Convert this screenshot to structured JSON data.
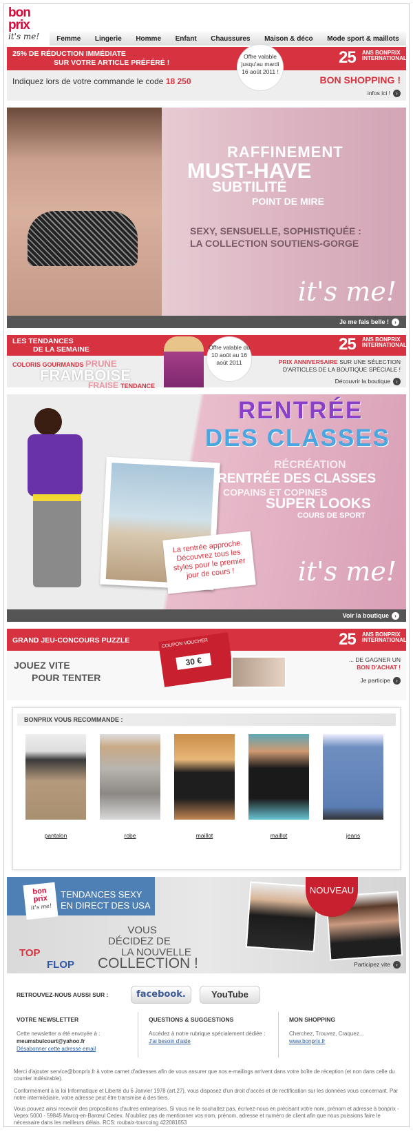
{
  "logo": {
    "line1": "bon",
    "line2": "prix",
    "tagline": "it's me!"
  },
  "nav": [
    "Femme",
    "Lingerie",
    "Homme",
    "Enfant",
    "Chaussures",
    "Maison & déco",
    "Mode sport & maillots"
  ],
  "promo": {
    "line1": "25% DE RÉDUCTION IMMÉDIATE",
    "line2": "SUR VOTRE ARTICLE PRÉFÉRÉ !",
    "offer": "Offre valable jusqu'au mardi 16 août 2011 !",
    "badge_num": "25",
    "badge_text": "ANS BONPRIX INTERNATIONAL",
    "code_text": "Indiquez lors de votre commande le code",
    "code": "18 250",
    "shopping": "BON SHOPPING !",
    "info": "infos ici !"
  },
  "hero1": {
    "w1": "RAFFINEMENT",
    "w2": "MUST-HAVE",
    "w3": "SUBTILITÉ",
    "w4": "POINT DE MIRE",
    "sub1": "SEXY, SENSUELLE, SOPHISTIQUÉE :",
    "sub2": "LA COLLECTION SOUTIENS-GORGE",
    "tagline": "it's me!",
    "link": "Je me fais belle !"
  },
  "trends": {
    "title1": "LES TENDANCES",
    "title2": "DE LA SEMAINE",
    "coloris": "COLORIS GOURMANDS",
    "prune": "PRUNE",
    "framboise": "FRAMBOISE",
    "fraise": "FRAISE",
    "tendance": "TENDANCE",
    "offer": "Offre valable du 10 août au 16 août 2011",
    "prix_b": "PRIX ANNIVERSAIRE",
    "prix_t": "SUR UNE SÉLECTION",
    "prix_t2": "D'ARTICLES DE LA BOUTIQUE SPÉCIALE !",
    "link": "Découvrir la boutique"
  },
  "hero2": {
    "rentree": "RENTRÉE",
    "classes": "DES CLASSES",
    "l1": "RÉCRÉATION",
    "l2": "RENTRÉE DES CLASSES",
    "l3": "COPAINS ET COPINES",
    "l4": "SUPER LOOKS",
    "l5": "COURS DE SPORT",
    "note": "La rentrée approche. Découvrez tous les styles pour le premier jour de cours !",
    "tagline": "it's me!",
    "link": "Voir la boutique"
  },
  "contest": {
    "title": "GRAND JEU-CONCOURS PUZZLE",
    "j1": "JOUEZ VITE",
    "j2": "POUR TENTER",
    "r1": "... DE GAGNER UN",
    "r2": "BON D'ACHAT !",
    "link": "Je participe",
    "voucher_top": "COUPON VOUCHER",
    "voucher_amt": "30 €"
  },
  "reco": {
    "title": "BONPRIX VOUS RECOMMANDE :",
    "items": [
      {
        "label": "pantalon"
      },
      {
        "label": "robe"
      },
      {
        "label": "maillot"
      },
      {
        "label": "maillot"
      },
      {
        "label": "jeans"
      }
    ]
  },
  "tendances": {
    "t1": "TENDANCES SEXY",
    "t2": "EN DIRECT DES USA",
    "v1": "VOUS",
    "v2": "DÉCIDEZ DE",
    "v3": "LA NOUVELLE",
    "v4": "COLLECTION !",
    "top": "TOP",
    "flop": "FLOP",
    "nouveau": "NOUVEAU",
    "link": "Participez vite"
  },
  "social": {
    "label": "RETROUVEZ-NOUS AUSSI SUR :",
    "facebook": "facebook.",
    "youtube": "YouTube"
  },
  "footer": {
    "news_h": "VOTRE NEWSLETTER",
    "news_t": "Cette newsletter a été envoyée à :",
    "news_email": "meumsbulcourt@yahoo.fr",
    "news_unsub": "Désabonner cette adresse email",
    "q_h": "QUESTIONS & SUGGESTIONS",
    "q_t": "Accédez à notre rubrique spécialement dédiée :",
    "q_link": "J'ai besoin d'aide",
    "s_h": "MON SHOPPING",
    "s_t": "Cherchez, Trouvez, Craquez...",
    "s_link": "www.bonprix.fr",
    "legal1": "Merci d'ajouter service@bonprix.fr à votre carnet d'adresses afin de vous assurer que nos e-mailings arrivent dans votre boîte de réception (et non dans celle du courrier indésirable).",
    "legal2": "Conformément à la loi Informatique et Liberté du 6 Janvier 1978 (art.27), vous disposez d'un droit d'accès et de rectification sur les données vous concernant. Par notre intermédiaire, votre adresse peut être transmise à des tiers.",
    "legal3": "Vous pouvez ainsi recevoir des propositions d'autres entreprises. Si vous ne le souhaitez pas, écrivez-nous en précisant votre nom, prénom et adresse à bonprix - Vepex 5000 - 59845 Marcq-en-Barœul Cedex. N'oubliez pas de mentionner vos nom, prénom, adresse et numéro de client afin que nous puissions faire le nécessaire dans les meilleurs délais. RCS: roubaix-tourcoing 422081653"
  },
  "colors": {
    "brand_red": "#d6323f",
    "logo_red": "#d40b3a",
    "dark_bar": "#555555",
    "link_blue": "#2b5aa0"
  }
}
